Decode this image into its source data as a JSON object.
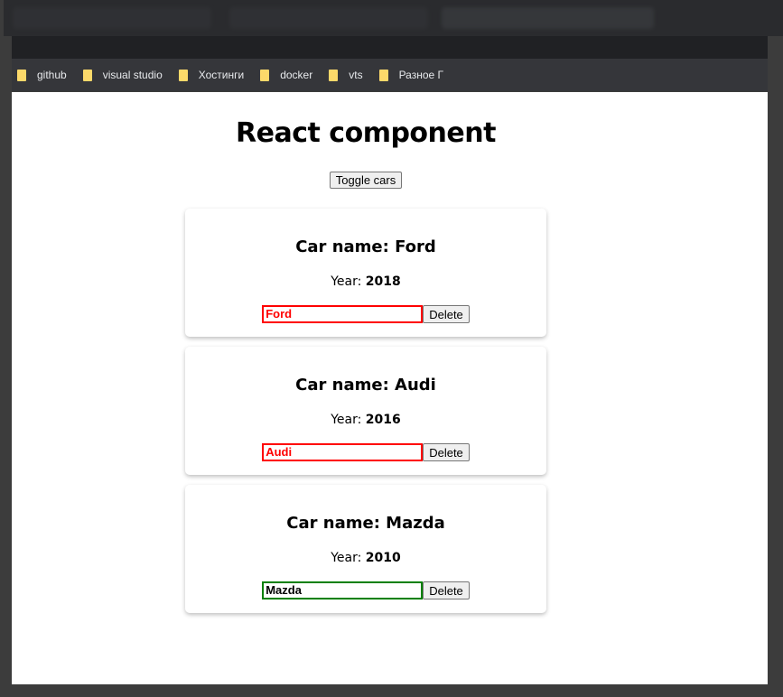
{
  "bookmarks": [
    "github",
    "visual studio",
    "Хостинги",
    "docker",
    "vts",
    "Разное Г"
  ],
  "page": {
    "title": "React component",
    "toggle_label": "Toggle cars",
    "cars": [
      {
        "heading": "Car name: Ford",
        "year_label": "Year: ",
        "year": "2018",
        "input_value": "Ford",
        "input_color": "#ff0000",
        "delete_label": "Delete"
      },
      {
        "heading": "Car name: Audi",
        "year_label": "Year: ",
        "year": "2016",
        "input_value": "Audi",
        "input_color": "#ff0000",
        "delete_label": "Delete"
      },
      {
        "heading": "Car name: Mazda",
        "year_label": "Year: ",
        "year": "2010",
        "input_value": "Mazda",
        "input_color": "#008000",
        "delete_label": "Delete"
      }
    ]
  }
}
